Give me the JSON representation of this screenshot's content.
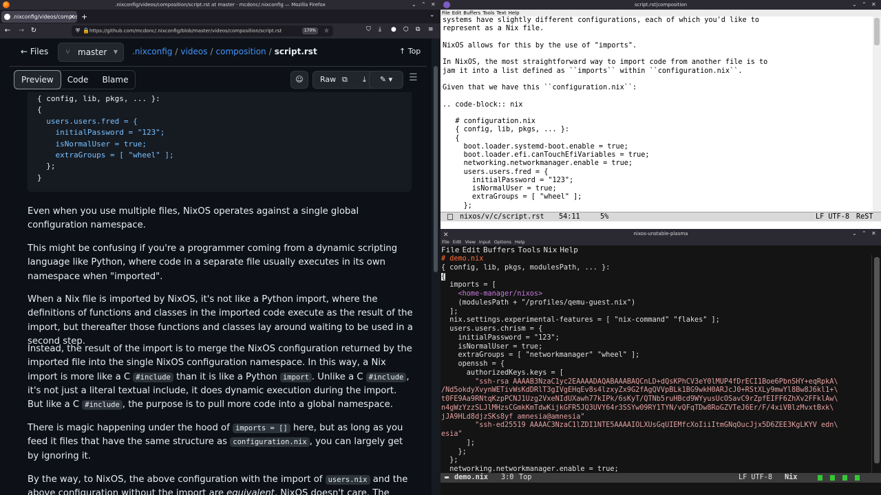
{
  "firefox": {
    "window_title": ".nixconfig/videos/composition/script.rst at master · mcdonc/.nixconfig — Mozilla Firefox",
    "tab_title": ".nixconfig/videos/compos",
    "url": "https://github.com/mcdonc/.nixconfig/blob/master/videos/composition/script.rst",
    "zoom": "170%"
  },
  "github": {
    "files_label": "Files",
    "branch": "master",
    "crumbs": [
      ".nixconfig",
      "videos",
      "composition"
    ],
    "current_file": "script.rst",
    "top_label": "Top",
    "tabs": [
      "Preview",
      "Code",
      "Blame"
    ],
    "raw_label": "Raw",
    "code_lines": [
      "{ config, lib, pkgs, ... }:",
      "{",
      "  users.users.fred = {",
      "    initialPassword = \"123\";",
      "    isNormalUser = true;",
      "    extraGroups = [ \"wheel\" ];",
      "  };",
      "}"
    ],
    "p1": "Even when you use multiple files, NixOS operates against a single global configuration namespace.",
    "p2": "This might be confusing if you're a programmer coming from a dynamic scripting language like Python, where code in a separate file usually executes in its own namespace when \"imported\".",
    "p3": "When a Nix file is imported by NixOS, it's not like a Python import, where the definitions of functions and classes in the imported code execute as the result of the import, but thereafter those functions and classes lay around waiting to be used in a second step.",
    "p4_a": "Instead, the result of the import is to merge the NixOS configuration returned by the imported file into the single NixOS configuration namespace. In this way, a Nix import is more like a C ",
    "p4_code1": "#include",
    "p4_b": " than it is like a Python ",
    "p4_code2": "import",
    "p4_c": ". Unlike a C ",
    "p4_code3": "#include",
    "p4_d": ", it's not just a literal textual include, it does dynamic execution during the import. But like a C ",
    "p4_code4": "#include",
    "p4_e": ", the purpose is to pull more code into a global namespace.",
    "p5_a": "There is magic happening under the hood of ",
    "p5_code1": "imports = []",
    "p5_b": " here, but as long as you feed it files that have the same structure as ",
    "p5_code2": "configuration.nix",
    "p5_c": ", you can largely get by ignoring it.",
    "p6_a": "By the way, to NixOS, the above configuration with the import of ",
    "p6_code1": "users.nix",
    "p6_b": " and the above configuration without the import are ",
    "p6_em": "equivalent",
    "p6_c": ". NixOS doesn't care. The resulting"
  },
  "emacs_top": {
    "window_title": "script.rst|composition",
    "menu": [
      "File",
      "Edit",
      "Buffers",
      "Tools",
      "Text",
      "Help"
    ],
    "lines": [
      "systems have slightly different configurations, each of which you'd like to",
      "represent as a Nix file.",
      "",
      "NixOS allows for this by the use of \"imports\".",
      "",
      "In NixOS, the most straightforward way to import code from another file is to",
      "jam it into a list defined as ``imports`` within ``configuration.nix``.",
      "",
      "Given that we have this ``configuration.nix``:",
      "",
      ".. code-block:: nix",
      "",
      "   # configuration.nix",
      "   { config, lib, pkgs, ... }:",
      "   {",
      "     boot.loader.systemd-boot.enable = true;",
      "     boot.loader.efi.canTouchEfiVariables = true;",
      "     networking.networkmanager.enable = true;",
      "     users.users.fred = {",
      "       initialPassword = \"123\";",
      "       isNormalUser = true;",
      "       extraGroups = [ \"wheel\" ];",
      "     };"
    ],
    "mode_buffer": "nixos/v/c/script.rst",
    "mode_pos": "54:11",
    "mode_pct": "5%",
    "mode_enc": "LF UTF-8",
    "mode_major": "ReST"
  },
  "emacs_bottom": {
    "window_title": "nixos-unstable-plasma",
    "konsole_menu": [
      "File",
      "Edit",
      "View",
      "Input",
      "Options",
      "Help"
    ],
    "menu": [
      "File",
      "Edit",
      "Buffers",
      "Tools",
      "Nix",
      "Help"
    ],
    "lines": [
      "# demo.nix",
      "{ config, lib, pkgs, modulesPath, ... }:",
      "{",
      "  imports = [",
      "    <home-manager/nixos>",
      "    (modulesPath + \"/profiles/qemu-guest.nix\")",
      "  ];",
      "  nix.settings.experimental-features = [ \"nix-command\" \"flakes\" ];",
      "  users.users.chrism = {",
      "    initialPassword = \"123\";",
      "    isNormalUser = true;",
      "    extraGroups = [ \"networkmanager\" \"wheel\" ];",
      "    openssh = {",
      "      authorizedKeys.keys = [",
      "        \"ssh-rsa AAAAB3NzaC1yc2EAAAADAQABAAABAQCnLD+dQsKPhCV3eY0lMUP4fDrECI1Boe6PbnSHY+eqRpkA\\",
      "/Nd5okdyXvynWETivWsKdDRlT3gIVgEHqEv8s4lzxyZx9G2fAgQVVpBLk1BG9wkH0ARJcJ0+RStXLy9mwYl8Bw8J6kl1+\\",
      "t0FE9Aa9RNtqKzpPCNJ1Uzg2VxeNIdUXawh77kIPk/6sKyT/QTNb5ruHBcd9WYyusUcOSavC9rZpfEIFF6ZhXv2FFklAw\\",
      "n4gWzYzzSLJlMHzsCGmkKmTdwKijkGFR5JQ3UVY64r3SSYw09RY1TYN/vQFqTDw8RoGZVTeJ6Er/F/4xiVBlzMvxtBxk\\",
      "jJA9HLd8djzSKs8yf amnesia@amnesia\"",
      "        \"ssh-ed25519 AAAAC3NzaC1lZDI1NTE5AAAAIOLXUsGqUIEMfcXoIiiItmGNqOucJjx5D6ZEE3KgLKYV edn\\",
      "esia\"",
      "      ];",
      "    };",
      "  };",
      "  networking.networkmanager.enable = true;"
    ],
    "mode_buffer": "demo.nix",
    "mode_pos": "3:0",
    "mode_top": "Top",
    "mode_enc": "LF UTF-8",
    "mode_major": "Nix"
  }
}
